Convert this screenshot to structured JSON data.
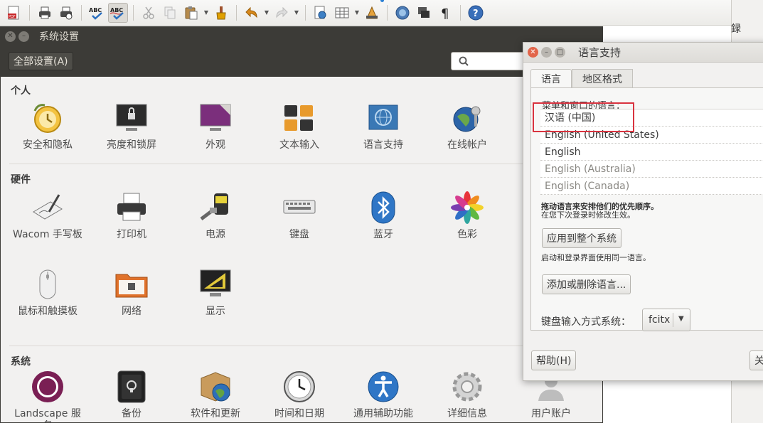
{
  "toolbar": {
    "icons": [
      "export-pdf-icon",
      "print-icon",
      "print-preview-icon",
      "spellcheck-icon",
      "autospellcheck-icon",
      "cut-icon",
      "copy-icon",
      "paste-icon",
      "clone-format-icon",
      "undo-icon",
      "redo-icon",
      "navigator-icon",
      "table-icon",
      "chart-icon",
      "sidebar-icon",
      "gallery-icon",
      "formatting-marks-icon",
      "help-icon"
    ],
    "right_text": "録"
  },
  "settings": {
    "title": "系统设置",
    "all_settings_label": "全部设置(A)",
    "sections": {
      "personal": {
        "title": "个人",
        "items": [
          "安全和隐私",
          "亮度和锁屏",
          "外观",
          "文本输入",
          "语言支持",
          "在线帐户"
        ]
      },
      "hardware": {
        "title": "硬件",
        "items": [
          "Wacom 手写板",
          "打印机",
          "电源",
          "键盘",
          "蓝牙",
          "色彩",
          "鼠标和触摸板",
          "网络",
          "显示"
        ]
      },
      "system": {
        "title": "系统",
        "items": [
          "Landscape 服务",
          "备份",
          "软件和更新",
          "时间和日期",
          "通用辅助功能",
          "详细信息",
          "用户账户"
        ]
      }
    }
  },
  "language_support": {
    "title": "语言支持",
    "tabs": [
      "语言",
      "地区格式"
    ],
    "menus_label": "菜单和窗口的语言：",
    "languages": [
      {
        "name": "汉语 (中国)",
        "muted": false
      },
      {
        "name": "English (United States)",
        "muted": false
      },
      {
        "name": "English",
        "muted": false
      },
      {
        "name": "English (Australia)",
        "muted": true
      },
      {
        "name": "English (Canada)",
        "muted": true
      }
    ],
    "drag_hint": "拖动语言来安排他们的优先顺序。",
    "relogin_hint": "在您下次登录时修改生效。",
    "apply_button": "应用到整个系统",
    "login_hint": "启动和登录界面使用同一语言。",
    "add_remove_button": "添加或删除语言...",
    "keyboard_label": "键盘输入方式系统：",
    "keyboard_value": "fcitx",
    "help_button": "帮助(H)",
    "close_button": "关"
  },
  "colors": {
    "titlebar": "#3c3b37",
    "window_bg": "#f2f1f0",
    "highlight_box": "#d9333f",
    "close_button": "#e2664b"
  }
}
